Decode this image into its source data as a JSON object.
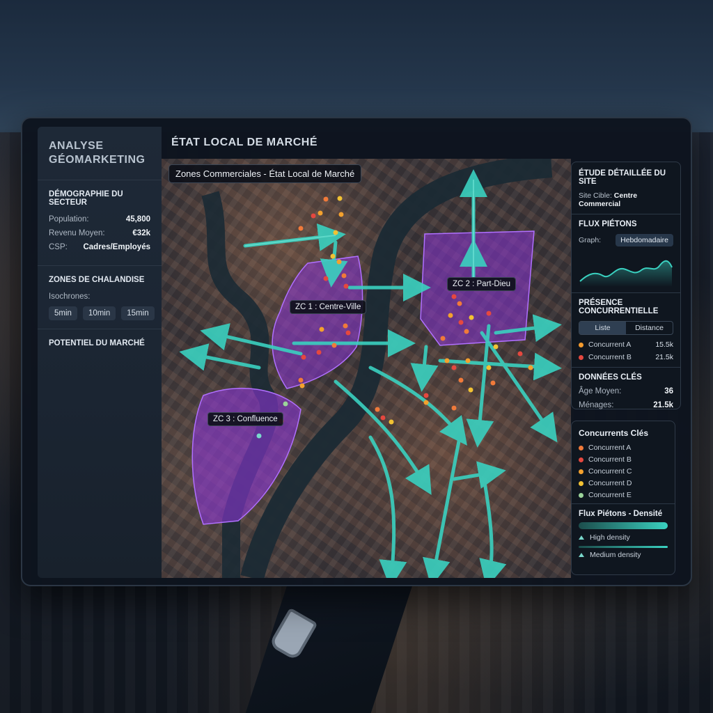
{
  "sidebar": {
    "title_line1": "ANALYSE",
    "title_line2": "GÉOMARKETING",
    "demographics": {
      "heading": "DÉMOGRAPHIE DU SECTEUR",
      "rows": [
        {
          "label": "Population:",
          "value": "45,800"
        },
        {
          "label": "Revenu Moyen:",
          "value": "€32k"
        },
        {
          "label": "CSP:",
          "value": "Cadres/Employés"
        }
      ]
    },
    "catchment": {
      "heading": "ZONES DE CHALANDISE",
      "isochrones_label": "Isochrones:",
      "isochrones": [
        "5min",
        "10min",
        "15min"
      ]
    },
    "potential": {
      "heading": "POTENTIEL DU MARCHÉ"
    }
  },
  "header": {
    "title": "ÉTAT LOCAL DE MARCHÉ"
  },
  "map": {
    "title": "Zones Commerciales - État Local de Marché",
    "zones": [
      "ZC 1 : Centre-Ville",
      "ZC 2 : Part-Dieu",
      "ZC 3 : Confluence"
    ],
    "colors": {
      "zone": "#8a35d6",
      "flow": "#3ad1c0"
    }
  },
  "site_panel": {
    "heading": "ÉTUDE DÉTAILLÉE DU SITE",
    "site_label": "Site Cible:",
    "site_value": "Centre Commercial",
    "flux_heading": "FLUX PIÉTONS",
    "graph_label": "Graph:",
    "graph_value": "Hebdomadaire",
    "competition_heading": "PRÉSENCE CONCURRENTIELLE",
    "tabs": [
      "Liste",
      "Distance"
    ],
    "competitors": [
      {
        "name": "Concurrent A",
        "value": "15.5k",
        "color": "#f39a2e"
      },
      {
        "name": "Concurrent B",
        "value": "21.5k",
        "color": "#e5483f"
      }
    ],
    "key_heading": "DONNÉES CLÉS",
    "key_rows": [
      {
        "label": "Âge Moyen:",
        "value": "36"
      },
      {
        "label": "Ménages:",
        "value": "21.5k"
      }
    ]
  },
  "legend_panel": {
    "heading": "Concurrents Clés",
    "items": [
      {
        "name": "Concurrent A",
        "color": "#f07a3a"
      },
      {
        "name": "Concurrent B",
        "color": "#e5483f"
      },
      {
        "name": "Concurrent C",
        "color": "#f3a12e"
      },
      {
        "name": "Concurrent D",
        "color": "#f2c233"
      },
      {
        "name": "Concurrent E",
        "color": "#9bd49a"
      }
    ],
    "density_heading": "Flux Piétons - Densité",
    "density_high": "High density",
    "density_medium": "Medium density"
  }
}
